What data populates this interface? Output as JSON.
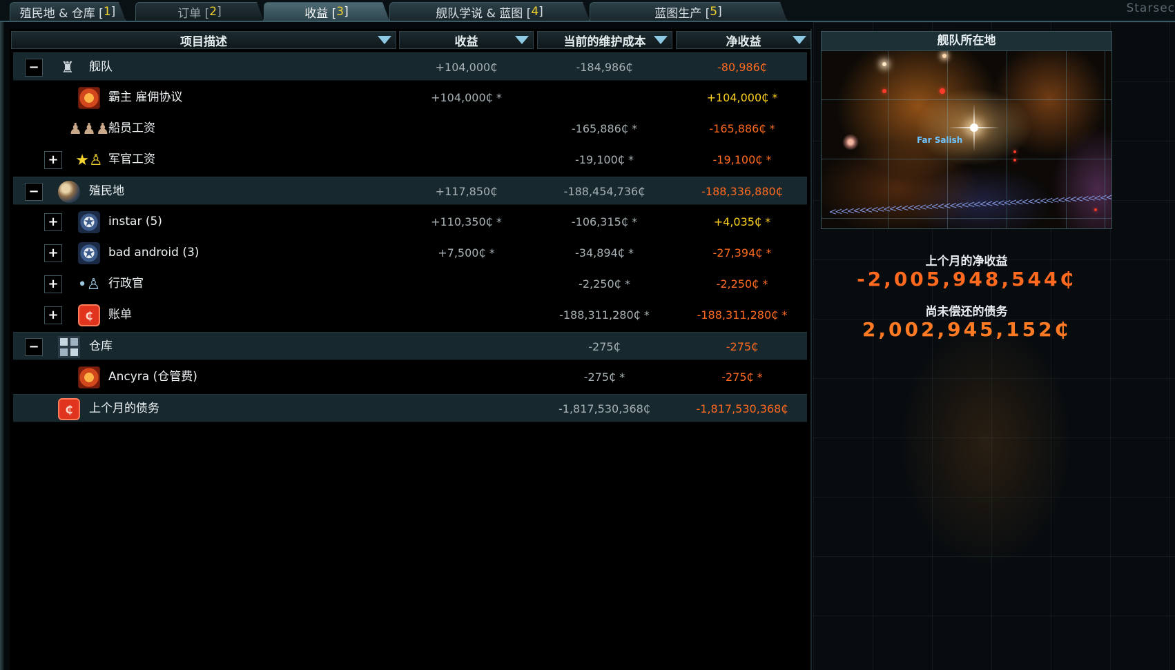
{
  "tabs": [
    {
      "label": "殖民地 & 仓库 [",
      "key": "1",
      "end": "]"
    },
    {
      "label": "订单 [",
      "key": "2",
      "end": "]"
    },
    {
      "label": "收益 [",
      "key": "3",
      "end": "]"
    },
    {
      "label": "舰队学说 & 蓝图 [",
      "key": "4",
      "end": "]"
    },
    {
      "label": "蓝图生产 [",
      "key": "5",
      "end": "]"
    }
  ],
  "corner_text": "Starsec",
  "columns": {
    "description": "项目描述",
    "income": "收益",
    "upkeep": "当前的维护成本",
    "net": "净收益"
  },
  "rows": [
    {
      "label": "舰队",
      "toggle": "−",
      "icon": "fleet-icon",
      "income": "+104,000₵",
      "upkeep": "-184,986₵",
      "net": "-80,986₵"
    },
    {
      "label": "霸主 雇佣协议",
      "toggle": "",
      "icon": "hegemony-emblem-icon",
      "income": "+104,000₵ *",
      "upkeep": "",
      "net": "+104,000₵ *"
    },
    {
      "label": "船员工资",
      "toggle": "",
      "icon": "crew-icon",
      "income": "",
      "upkeep": "-165,886₵ *",
      "net": "-165,886₵ *"
    },
    {
      "label": "军官工资",
      "toggle": "+",
      "icon": "officer-icon",
      "income": "",
      "upkeep": "-19,100₵ *",
      "net": "-19,100₵ *"
    },
    {
      "label": "殖民地",
      "toggle": "−",
      "icon": "planet-icon",
      "income": "+117,850₵",
      "upkeep": "-188,454,736₵",
      "net": "-188,336,880₵"
    },
    {
      "label": "instar (5)",
      "toggle": "+",
      "icon": "faction-star-icon",
      "income": "+110,350₵ *",
      "upkeep": "-106,315₵ *",
      "net": "+4,035₵ *"
    },
    {
      "label": "bad android (3)",
      "toggle": "+",
      "icon": "faction-star-icon",
      "income": "+7,500₵ *",
      "upkeep": "-34,894₵ *",
      "net": "-27,394₵ *"
    },
    {
      "label": "行政官",
      "toggle": "+",
      "icon": "administrator-icon",
      "income": "",
      "upkeep": "-2,250₵ *",
      "net": "-2,250₵ *"
    },
    {
      "label": "账单",
      "toggle": "+",
      "icon": "bill-icon",
      "income": "",
      "upkeep": "-188,311,280₵ *",
      "net": "-188,311,280₵ *"
    },
    {
      "label": "仓库",
      "toggle": "−",
      "icon": "storage-icon",
      "income": "",
      "upkeep": "-275₵",
      "net": "-275₵"
    },
    {
      "label": "Ancyra (仓管费)",
      "toggle": "",
      "icon": "hegemony-emblem-icon",
      "income": "",
      "upkeep": "-275₵ *",
      "net": "-275₵ *"
    },
    {
      "label": "上个月的债务",
      "toggle": "",
      "icon": "debt-icon",
      "income": "",
      "upkeep": "-1,817,530,368₵",
      "net": "-1,817,530,368₵"
    }
  ],
  "map": {
    "title": "舰队所在地",
    "location_label": "Far Salish"
  },
  "summary": {
    "last_month_label": "上个月的净收益",
    "last_month_value": "-2,005,948,544₵",
    "debt_label": "尚未偿还的债务",
    "debt_value": "2,002,945,152₵"
  },
  "colors": {
    "negative": "#ff6a1f",
    "positive": "#ffd21e",
    "hotkey": "#f3d230",
    "highlight_row": "#17292f"
  }
}
